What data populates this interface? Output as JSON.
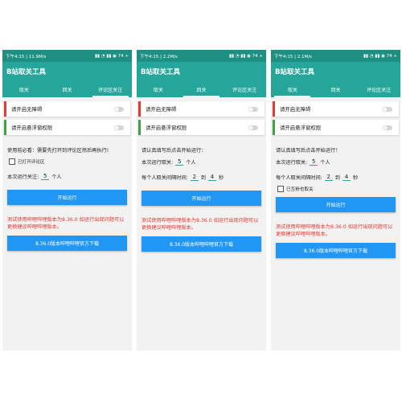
{
  "phones": [
    {
      "status_time": "下午4:15 | 11.9M/s",
      "status_right": "▮▮ ◔ ▮▮ ◉ 74 +",
      "title": "B站取关工具",
      "tabs": [
        "取关",
        "回关",
        "评论区关注"
      ],
      "active_tab": 2,
      "perm1": "请开启无障碍",
      "perm2": "请开启悬浮窗权限",
      "instruction": "使用前必看：需要先打开到评论区然后再执行!",
      "checkbox_label": "已打开评论区",
      "count_prefix": "本次运行关注:",
      "count_value": "5",
      "count_unit": "个人",
      "start_button": "开始运行",
      "warning": "测试使用哔哩哔哩版本为8.36.0 如运行出现问题可以更换建议哔哩哔哩版本。",
      "download_button": "8.36.0版本哔哩哔哩官方下载"
    },
    {
      "status_time": "下午4:15 | 2.2M/s",
      "status_right": "▮▮ ◔ ▮▮ ◉ 74 +",
      "title": "B站取关工具",
      "tabs": [
        "取关",
        "回关",
        "评论区关注"
      ],
      "active_tab": 1,
      "perm1": "请开启无障碍",
      "perm2": "请开启悬浮窗权限",
      "instruction": "请认真填写后点击开始运行：",
      "count_prefix": "本次运行取关:",
      "count_value": "5",
      "count_unit": "个人",
      "interval_prefix": "每个人取关间隔时间:",
      "interval_from": "2",
      "interval_to_label": "到",
      "interval_to": "4",
      "interval_unit": "秒",
      "start_button": "开始运行",
      "warning": "测试使用哔哩哔哩版本为8.36.0 如运行出现问题可以更换建议哔哩哔哩版本。",
      "download_button": "8.36.0版本哔哩哔哩官方下载"
    },
    {
      "status_time": "下午4:15 | 2.1M/s",
      "status_right": "▮▮ ◔ ▮▮ ◉ 74 +",
      "title": "B站取关工具",
      "tabs": [
        "取关",
        "回关",
        "评论区关注"
      ],
      "active_tab": 0,
      "perm1": "请开启无障碍",
      "perm2": "请开启悬浮窗权限",
      "instruction": "请认真填写后点击开始运行！",
      "count_prefix": "本次运行取关:",
      "count_value": "5",
      "count_unit": "个人",
      "interval_prefix": "每个人取关间隔时间:",
      "interval_from": "2",
      "interval_to_label": "到",
      "interval_to": "4",
      "interval_unit": "秒",
      "checkbox_label": "已互粉也取关",
      "start_button": "开始运行",
      "warning": "测试使用哔哩哔哩版本为8.36.0 如运行出现问题可以更换建议哔哩哔哩版本。",
      "download_button": "8.36.0版本哔哩哔哩官方下载"
    }
  ]
}
